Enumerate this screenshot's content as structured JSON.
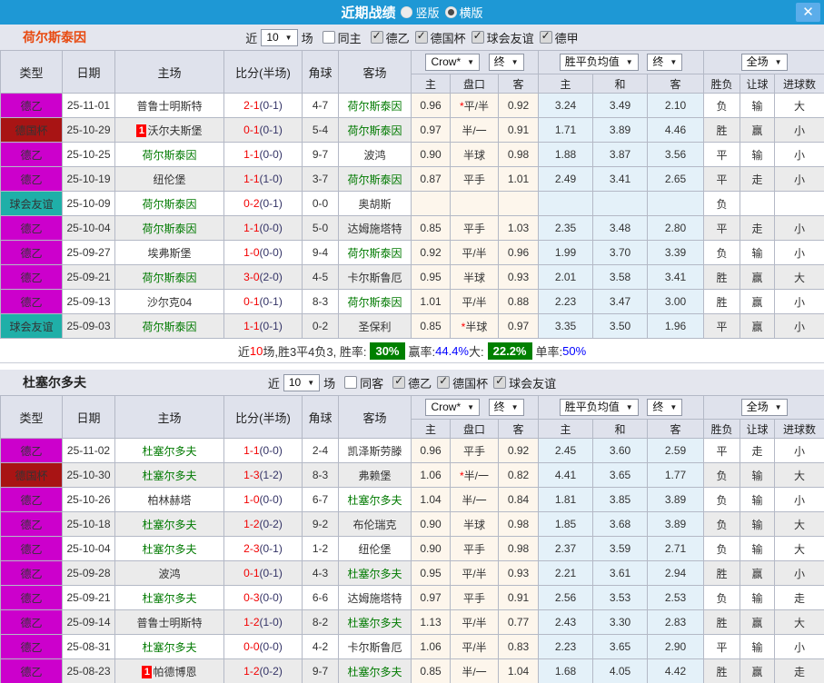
{
  "titlebar": {
    "title": "近期战绩",
    "vertical_label": "竖版",
    "horizontal_label": "横版",
    "selected_mode": "横版",
    "close_glyph": "✕",
    "bar_color": "#1e98d5"
  },
  "columns": {
    "type": "类型",
    "date": "日期",
    "home": "主场",
    "score": "比分(半场)",
    "corner": "角球",
    "away": "客场",
    "odds_source": "Crow*",
    "final": "终",
    "mean": "胜平负均值",
    "final2": "终",
    "fullmatch": "全场",
    "sub": [
      "主",
      "盘口",
      "客",
      "主",
      "和",
      "客",
      "胜负",
      "让球",
      "进球数"
    ]
  },
  "type_colors": {
    "德乙": "#cc00cc",
    "德国杯": "#a81414",
    "球会友谊": "#1fafa8"
  },
  "sections": [
    {
      "team": "荷尔斯泰因",
      "team_color": "#e8490f",
      "filter": {
        "near": "近",
        "count": "10",
        "matches": "场",
        "same": "同主",
        "same_checked": false,
        "leagues": [
          "德乙",
          "德国杯",
          "球会友谊",
          "德甲"
        ]
      },
      "rows": [
        {
          "type": "德乙",
          "date": "25-11-01",
          "home": "普鲁士明斯特",
          "home_green": false,
          "home_rc": false,
          "score": "2-1",
          "half": "(0-1)",
          "corner": "4-7",
          "away": "荷尔斯泰因",
          "away_green": true,
          "o1": "0.96",
          "hstar": true,
          "handicap": "平/半",
          "o2": "0.92",
          "m1": "3.24",
          "m2": "3.49",
          "m3": "2.10",
          "res": "负",
          "let": "输",
          "goal": "大"
        },
        {
          "type": "德国杯",
          "date": "25-10-29",
          "home": "沃尔夫斯堡",
          "home_green": false,
          "home_rc": true,
          "score": "0-1",
          "half": "(0-1)",
          "corner": "5-4",
          "away": "荷尔斯泰因",
          "away_green": true,
          "o1": "0.97",
          "hstar": false,
          "handicap": "半/一",
          "o2": "0.91",
          "m1": "1.71",
          "m2": "3.89",
          "m3": "4.46",
          "res": "胜",
          "let": "赢",
          "goal": "小"
        },
        {
          "type": "德乙",
          "date": "25-10-25",
          "home": "荷尔斯泰因",
          "home_green": true,
          "home_rc": false,
          "score": "1-1",
          "half": "(0-0)",
          "corner": "9-7",
          "away": "波鸿",
          "away_green": false,
          "o1": "0.90",
          "hstar": false,
          "handicap": "半球",
          "o2": "0.98",
          "m1": "1.88",
          "m2": "3.87",
          "m3": "3.56",
          "res": "平",
          "let": "输",
          "goal": "小"
        },
        {
          "type": "德乙",
          "date": "25-10-19",
          "home": "纽伦堡",
          "home_green": false,
          "home_rc": false,
          "score": "1-1",
          "half": "(1-0)",
          "corner": "3-7",
          "away": "荷尔斯泰因",
          "away_green": true,
          "o1": "0.87",
          "hstar": false,
          "handicap": "平手",
          "o2": "1.01",
          "m1": "2.49",
          "m2": "3.41",
          "m3": "2.65",
          "res": "平",
          "let": "走",
          "goal": "小"
        },
        {
          "type": "球会友谊",
          "date": "25-10-09",
          "home": "荷尔斯泰因",
          "home_green": true,
          "home_rc": false,
          "score": "0-2",
          "half": "(0-1)",
          "corner": "0-0",
          "away": "奥胡斯",
          "away_green": false,
          "o1": "",
          "hstar": false,
          "handicap": "",
          "o2": "",
          "m1": "",
          "m2": "",
          "m3": "",
          "res": "负",
          "let": "",
          "goal": ""
        },
        {
          "type": "德乙",
          "date": "25-10-04",
          "home": "荷尔斯泰因",
          "home_green": true,
          "home_rc": false,
          "score": "1-1",
          "half": "(0-0)",
          "corner": "5-0",
          "away": "达姆施塔特",
          "away_green": false,
          "o1": "0.85",
          "hstar": false,
          "handicap": "平手",
          "o2": "1.03",
          "m1": "2.35",
          "m2": "3.48",
          "m3": "2.80",
          "res": "平",
          "let": "走",
          "goal": "小"
        },
        {
          "type": "德乙",
          "date": "25-09-27",
          "home": "埃弗斯堡",
          "home_green": false,
          "home_rc": false,
          "score": "1-0",
          "half": "(0-0)",
          "corner": "9-4",
          "away": "荷尔斯泰因",
          "away_green": true,
          "o1": "0.92",
          "hstar": false,
          "handicap": "平/半",
          "o2": "0.96",
          "m1": "1.99",
          "m2": "3.70",
          "m3": "3.39",
          "res": "负",
          "let": "输",
          "goal": "小"
        },
        {
          "type": "德乙",
          "date": "25-09-21",
          "home": "荷尔斯泰因",
          "home_green": true,
          "home_rc": false,
          "score": "3-0",
          "half": "(2-0)",
          "corner": "4-5",
          "away": "卡尔斯鲁厄",
          "away_green": false,
          "o1": "0.95",
          "hstar": false,
          "handicap": "半球",
          "o2": "0.93",
          "m1": "2.01",
          "m2": "3.58",
          "m3": "3.41",
          "res": "胜",
          "let": "赢",
          "goal": "大"
        },
        {
          "type": "德乙",
          "date": "25-09-13",
          "home": "沙尔克04",
          "home_green": false,
          "home_rc": false,
          "score": "0-1",
          "half": "(0-1)",
          "corner": "8-3",
          "away": "荷尔斯泰因",
          "away_green": true,
          "o1": "1.01",
          "hstar": false,
          "handicap": "平/半",
          "o2": "0.88",
          "m1": "2.23",
          "m2": "3.47",
          "m3": "3.00",
          "res": "胜",
          "let": "赢",
          "goal": "小"
        },
        {
          "type": "球会友谊",
          "date": "25-09-03",
          "home": "荷尔斯泰因",
          "home_green": true,
          "home_rc": false,
          "score": "1-1",
          "half": "(0-1)",
          "corner": "0-2",
          "away": "圣保利",
          "away_green": false,
          "o1": "0.85",
          "hstar": true,
          "handicap": "半球",
          "o2": "0.97",
          "m1": "3.35",
          "m2": "3.50",
          "m3": "1.96",
          "res": "平",
          "let": "赢",
          "goal": "小"
        }
      ],
      "summary": {
        "pre": "近",
        "count": "10",
        "mid": "场,胜3平4负3, 胜率:",
        "win_rate": "30%",
        "label_yl": "赢率:",
        "yl": "44.4%",
        "label_big": "大:",
        "big": "22.2%",
        "label_single": "单率:",
        "single": "50%"
      }
    },
    {
      "team": "杜塞尔多夫",
      "team_color": "#222222",
      "filter": {
        "near": "近",
        "count": "10",
        "matches": "场",
        "same": "同客",
        "same_checked": false,
        "leagues": [
          "德乙",
          "德国杯",
          "球会友谊"
        ]
      },
      "rows": [
        {
          "type": "德乙",
          "date": "25-11-02",
          "home": "杜塞尔多夫",
          "home_green": true,
          "home_rc": false,
          "score": "1-1",
          "half": "(0-0)",
          "corner": "2-4",
          "away": "凯泽斯劳滕",
          "away_green": false,
          "o1": "0.96",
          "hstar": false,
          "handicap": "平手",
          "o2": "0.92",
          "m1": "2.45",
          "m2": "3.60",
          "m3": "2.59",
          "res": "平",
          "let": "走",
          "goal": "小"
        },
        {
          "type": "德国杯",
          "date": "25-10-30",
          "home": "杜塞尔多夫",
          "home_green": true,
          "home_rc": false,
          "score": "1-3",
          "half": "(1-2)",
          "corner": "8-3",
          "away": "弗赖堡",
          "away_green": false,
          "o1": "1.06",
          "hstar": true,
          "handicap": "半/一",
          "o2": "0.82",
          "m1": "4.41",
          "m2": "3.65",
          "m3": "1.77",
          "res": "负",
          "let": "输",
          "goal": "大"
        },
        {
          "type": "德乙",
          "date": "25-10-26",
          "home": "柏林赫塔",
          "home_green": false,
          "home_rc": false,
          "score": "1-0",
          "half": "(0-0)",
          "corner": "6-7",
          "away": "杜塞尔多夫",
          "away_green": true,
          "o1": "1.04",
          "hstar": false,
          "handicap": "半/一",
          "o2": "0.84",
          "m1": "1.81",
          "m2": "3.85",
          "m3": "3.89",
          "res": "负",
          "let": "输",
          "goal": "小"
        },
        {
          "type": "德乙",
          "date": "25-10-18",
          "home": "杜塞尔多夫",
          "home_green": true,
          "home_rc": false,
          "score": "1-2",
          "half": "(0-2)",
          "corner": "9-2",
          "away": "布伦瑞克",
          "away_green": false,
          "o1": "0.90",
          "hstar": false,
          "handicap": "半球",
          "o2": "0.98",
          "m1": "1.85",
          "m2": "3.68",
          "m3": "3.89",
          "res": "负",
          "let": "输",
          "goal": "大"
        },
        {
          "type": "德乙",
          "date": "25-10-04",
          "home": "杜塞尔多夫",
          "home_green": true,
          "home_rc": false,
          "score": "2-3",
          "half": "(0-1)",
          "corner": "1-2",
          "away": "纽伦堡",
          "away_green": false,
          "o1": "0.90",
          "hstar": false,
          "handicap": "平手",
          "o2": "0.98",
          "m1": "2.37",
          "m2": "3.59",
          "m3": "2.71",
          "res": "负",
          "let": "输",
          "goal": "大"
        },
        {
          "type": "德乙",
          "date": "25-09-28",
          "home": "波鸿",
          "home_green": false,
          "home_rc": false,
          "score": "0-1",
          "half": "(0-1)",
          "corner": "4-3",
          "away": "杜塞尔多夫",
          "away_green": true,
          "o1": "0.95",
          "hstar": false,
          "handicap": "平/半",
          "o2": "0.93",
          "m1": "2.21",
          "m2": "3.61",
          "m3": "2.94",
          "res": "胜",
          "let": "赢",
          "goal": "小"
        },
        {
          "type": "德乙",
          "date": "25-09-21",
          "home": "杜塞尔多夫",
          "home_green": true,
          "home_rc": false,
          "score": "0-3",
          "half": "(0-0)",
          "corner": "6-6",
          "away": "达姆施塔特",
          "away_green": false,
          "o1": "0.97",
          "hstar": false,
          "handicap": "平手",
          "o2": "0.91",
          "m1": "2.56",
          "m2": "3.53",
          "m3": "2.53",
          "res": "负",
          "let": "输",
          "goal": "走"
        },
        {
          "type": "德乙",
          "date": "25-09-14",
          "home": "普鲁士明斯特",
          "home_green": false,
          "home_rc": false,
          "score": "1-2",
          "half": "(1-0)",
          "corner": "8-2",
          "away": "杜塞尔多夫",
          "away_green": true,
          "o1": "1.13",
          "hstar": false,
          "handicap": "平/半",
          "o2": "0.77",
          "m1": "2.43",
          "m2": "3.30",
          "m3": "2.83",
          "res": "胜",
          "let": "赢",
          "goal": "大"
        },
        {
          "type": "德乙",
          "date": "25-08-31",
          "home": "杜塞尔多夫",
          "home_green": true,
          "home_rc": false,
          "score": "0-0",
          "half": "(0-0)",
          "corner": "4-2",
          "away": "卡尔斯鲁厄",
          "away_green": false,
          "o1": "1.06",
          "hstar": false,
          "handicap": "平/半",
          "o2": "0.83",
          "m1": "2.23",
          "m2": "3.65",
          "m3": "2.90",
          "res": "平",
          "let": "输",
          "goal": "小"
        },
        {
          "type": "德乙",
          "date": "25-08-23",
          "home": "帕德博恩",
          "home_green": false,
          "home_rc": true,
          "score": "1-2",
          "half": "(0-2)",
          "corner": "9-7",
          "away": "杜塞尔多夫",
          "away_green": true,
          "o1": "0.85",
          "hstar": false,
          "handicap": "半/一",
          "o2": "1.04",
          "m1": "1.68",
          "m2": "4.05",
          "m3": "4.42",
          "res": "胜",
          "let": "赢",
          "goal": "走"
        }
      ],
      "summary": null
    }
  ]
}
